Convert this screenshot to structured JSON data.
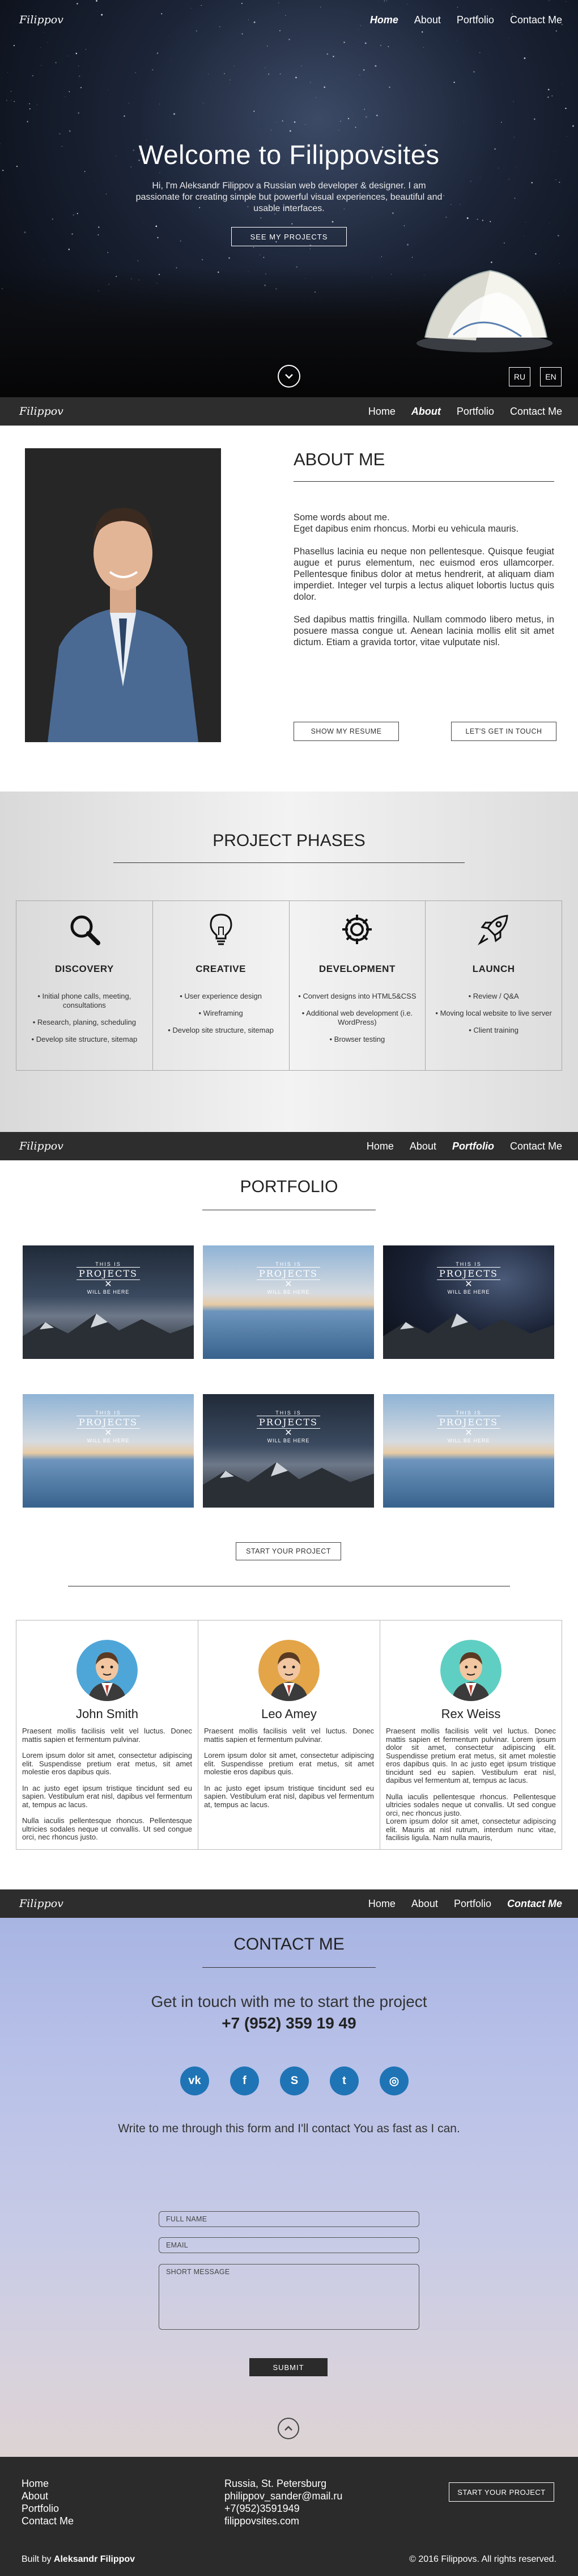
{
  "brand": {
    "logo": "Filippov"
  },
  "nav": {
    "home": "Home",
    "about": "About",
    "portfolio": "Portfolio",
    "contact": "Contact Me"
  },
  "hero": {
    "title": "Welcome to Filippovsites",
    "subtitle": "Hi, I'm Aleksandr Filippov a Russian web developer & designer. I am passionate for creating simple but powerful visual experiences, beautiful and usable interfaces.",
    "button": "SEE MY PROJECTS",
    "lang_ru": "RU",
    "lang_en": "EN",
    "scroll_icon": "chevron-down-icon"
  },
  "about": {
    "title": "ABOUT ME",
    "paragraphs": [
      "Some words about me.\nEget dapibus enim rhoncus. Morbi eu vehicula mauris.",
      "Phasellus lacinia eu neque non pellentesque. Quisque feugiat augue et purus elementum, nec euismod eros ullamcorper. Pellentesque finibus dolor at metus hendrerit, at aliquam diam imperdiet. Integer vel turpis a lectus aliquet lobortis luctus quis dolor.",
      "Sed dapibus mattis fringilla. Nullam commodo libero metus, in posuere massa congue ut. Aenean lacinia mollis elit sit amet dictum. Etiam a gravida tortor, vitae vulputate nisl."
    ],
    "resume_button": "SHOW MY RESUME",
    "touch_button": "LET'S GET IN TOUCH"
  },
  "phases": {
    "title": "PROJECT PHASES",
    "items": [
      {
        "name": "DISCOVERY",
        "icon": "magnifier-icon",
        "points": [
          "Initial phone calls, meeting, consultations",
          "Research, planing, scheduling",
          "Develop site structure, sitemap"
        ]
      },
      {
        "name": "CREATIVE",
        "icon": "lightbulb-icon",
        "points": [
          "User experience design",
          "Wireframing",
          "Develop site structure, sitemap"
        ]
      },
      {
        "name": "DEVELOPMENT",
        "icon": "gear-icon",
        "points": [
          "Convert designs into HTML5&CSS",
          "Additional web development (i.e. WordPress)",
          "Browser testing"
        ]
      },
      {
        "name": "LAUNCH",
        "icon": "rocket-icon",
        "points": [
          "Review / Q&A",
          "Moving local website to live server",
          "Client training"
        ]
      }
    ]
  },
  "portfolio": {
    "title": "PORTFOLIO",
    "badge": {
      "top": "THIS IS",
      "main": "PROJECTS",
      "script": "Filippov",
      "sub": "WILL BE HERE"
    },
    "thumbs": [
      "dark",
      "sea",
      "night",
      "sea",
      "dark",
      "sea"
    ],
    "button": "START YOUR PROJECT",
    "team": [
      {
        "name": "John Smith",
        "avatar_color": "#4ea6d8",
        "paragraphs": [
          "Praesent mollis facilisis velit vel luctus. Donec mattis sapien et fermentum pulvinar.",
          "Lorem ipsum dolor sit amet, consectetur adipiscing elit. Suspendisse pretium erat metus, sit amet molestie eros dapibus quis.",
          "In ac justo eget ipsum tristique tincidunt sed eu sapien. Vestibulum erat nisl, dapibus vel fermentum at, tempus ac lacus.",
          "Nulla iaculis pellentesque rhoncus. Pellentesque ultricies sodales neque ut convallis. Ut sed congue orci, nec rhoncus justo."
        ]
      },
      {
        "name": "Leo Amey",
        "avatar_color": "#e3a548",
        "paragraphs": [
          "Praesent mollis facilisis velit vel luctus. Donec mattis sapien et fermentum pulvinar.",
          "Lorem ipsum dolor sit amet, consectetur adipiscing elit. Suspendisse pretium erat metus, sit amet molestie eros dapibus quis.",
          "In ac justo eget ipsum tristique tincidunt sed eu sapien. Vestibulum erat nisl, dapibus vel fermentum at, tempus ac lacus."
        ]
      },
      {
        "name": "Rex Weiss",
        "avatar_color": "#5fcfc3",
        "paragraphs": [
          "Praesent mollis facilisis velit vel luctus. Donec mattis sapien et fermentum pulvinar. Lorem ipsum dolor sit amet, consectetur adipiscing elit. Suspendisse pretium erat metus, sit amet molestie eros dapibus quis. In ac justo eget ipsum tristique tincidunt sed eu sapien. Vestibulum erat nisl, dapibus vel fermentum at, tempus ac lacus.",
          "Nulla iaculis pellentesque rhoncus. Pellentesque ultricies sodales neque ut convallis. Ut sed congue orci, nec rhoncus justo.\nLorem ipsum dolor sit amet, consectetur adipiscing elit. Mauris at nisl rutrum, interdum nunc vitae, facilisis ligula. Nam nulla mauris,"
        ]
      }
    ]
  },
  "contact": {
    "title": "CONTACT ME",
    "lead": "Get in touch with me to start the project",
    "phone": "+7 (952) 359 19 49",
    "socials": [
      {
        "name": "vk-icon",
        "glyph": "vk"
      },
      {
        "name": "facebook-icon",
        "glyph": "f"
      },
      {
        "name": "skype-icon",
        "glyph": "S"
      },
      {
        "name": "twitter-icon",
        "glyph": "t"
      },
      {
        "name": "instagram-icon",
        "glyph": "◎"
      }
    ],
    "note": "Write to me through this form and I'll contact You as fast as I can.",
    "full_name_placeholder": "FULL NAME",
    "email_placeholder": "EMAIL",
    "message_placeholder": "SHORT MESSAGE",
    "submit": "SUBMIT",
    "up_icon": "chevron-up-icon"
  },
  "footer": {
    "links": [
      "Home",
      "About",
      "Portfolio",
      "Contact Me"
    ],
    "address": [
      "Russia, St. Petersburg",
      "philippov_sander@mail.ru",
      "+7(952)3591949",
      "filippovsites.com"
    ],
    "button": "START YOUR PROJECT",
    "built_prefix": "Built by",
    "built_name": "Aleksandr Filippov",
    "copyright": "© 2016 Filippovs. All rights reserved."
  },
  "colors": {
    "dark": "#2d2d2d",
    "social_blue": "#1f74b5"
  }
}
